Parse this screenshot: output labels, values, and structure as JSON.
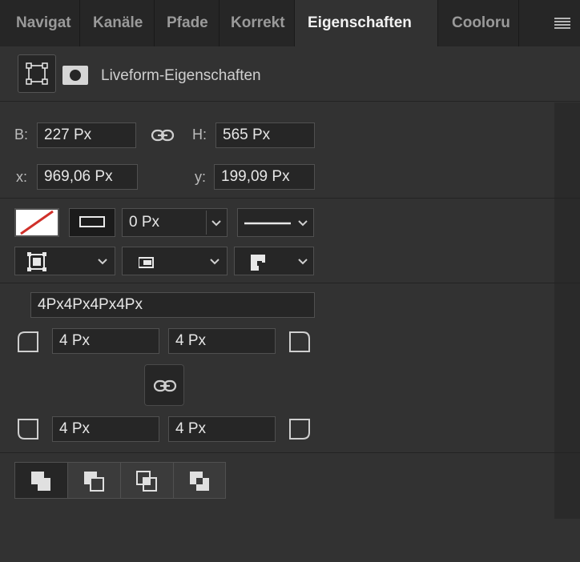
{
  "tabs": [
    {
      "label": "Navigat",
      "active": false
    },
    {
      "label": "Kanäle",
      "active": false
    },
    {
      "label": "Pfade",
      "active": false
    },
    {
      "label": "Korrekt",
      "active": false
    },
    {
      "label": "Eigenschaften",
      "active": true
    },
    {
      "label": "Cooloru",
      "active": false
    }
  ],
  "header": {
    "title": "Liveform-Eigenschaften"
  },
  "transform": {
    "width_label": "B:",
    "width_value": "227 Px",
    "height_label": "H:",
    "height_value": "565 Px",
    "x_label": "x:",
    "x_value": "969,06 Px",
    "y_label": "y:",
    "y_value": "199,09 Px"
  },
  "stroke": {
    "width_value": "0 Px",
    "fill_color": "#ffffff",
    "no_fill_slash_color": "#d0302a"
  },
  "corners": {
    "combined_value": "4Px4Px4Px4Px",
    "top_left": "4 Px",
    "top_right": "4 Px",
    "bottom_left": "4 Px",
    "bottom_right": "4 Px"
  },
  "icons": {
    "transform": "bounding-box-icon",
    "mask": "mask-icon",
    "link": "link-icon",
    "menu": "panel-menu-icon"
  }
}
